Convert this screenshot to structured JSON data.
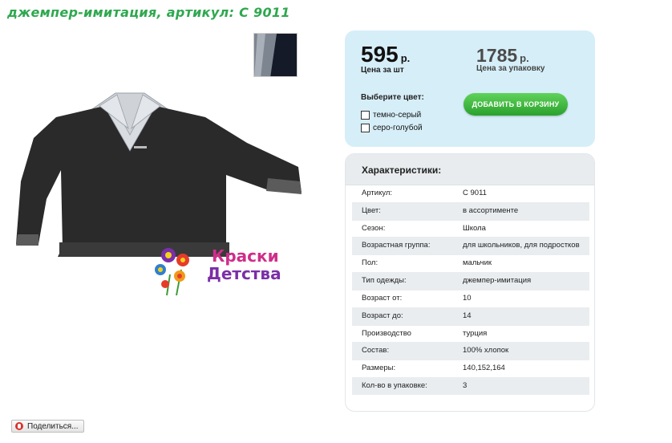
{
  "page": {
    "title": "джемпер-имитация, артикул: С 9011"
  },
  "price": {
    "unit_value": "595",
    "unit_currency": "р.",
    "unit_label": "Цена за шт",
    "pack_value": "1785",
    "pack_currency": "р.",
    "pack_label": "Цена за упаковку"
  },
  "colors": {
    "heading": "Выберите цвет:",
    "options": [
      "темно-серый",
      "серо-голубой"
    ]
  },
  "cart": {
    "button_label": "ДОБАВИТЬ В КОРЗИНУ"
  },
  "specs": {
    "heading": "Характеристики:",
    "rows": [
      {
        "key": "Артикул:",
        "value": "С 9011"
      },
      {
        "key": "Цвет:",
        "value": "в ассортименте"
      },
      {
        "key": "Сезон:",
        "value": "Школа"
      },
      {
        "key": "Возрастная группа:",
        "value": "для школьников, для подростков"
      },
      {
        "key": "Пол:",
        "value": "мальчик"
      },
      {
        "key": "Тип одежды:",
        "value": "джемпер-имитация"
      },
      {
        "key": "Возраст от:",
        "value": "10"
      },
      {
        "key": "Возраст до:",
        "value": "14"
      },
      {
        "key": "Производство",
        "value": "турция"
      },
      {
        "key": "Состав:",
        "value": "100% хлопок"
      },
      {
        "key": "Размеры:",
        "value": "140,152,164"
      },
      {
        "key": "Кол-во в упаковке:",
        "value": "3"
      }
    ]
  },
  "brand": {
    "line1": "Краски",
    "line2": "Детства"
  },
  "share": {
    "label": "Поделиться..."
  },
  "theme": {
    "title_color": "#2fa84f",
    "panel_bg": "#d6eef8",
    "button_green": "#2aa12c"
  }
}
